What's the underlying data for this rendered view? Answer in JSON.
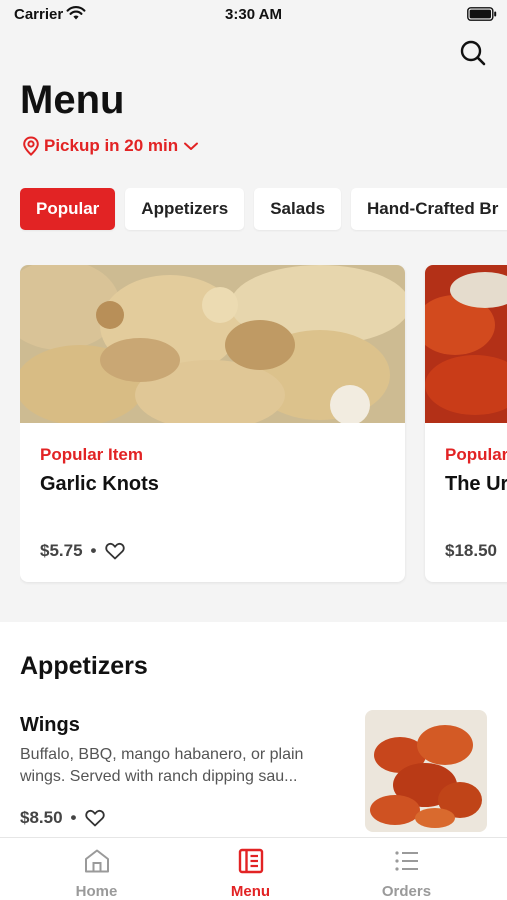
{
  "status_bar": {
    "carrier": "Carrier",
    "time": "3:30 AM"
  },
  "header": {
    "title": "Menu",
    "pickup_label": "Pickup in 20 min"
  },
  "categories": [
    {
      "label": "Popular",
      "active": true
    },
    {
      "label": "Appetizers",
      "active": false
    },
    {
      "label": "Salads",
      "active": false
    },
    {
      "label": "Hand-Crafted Br",
      "active": false
    }
  ],
  "popular_cards": [
    {
      "tag": "Popular Item",
      "name": "Garlic Knots",
      "price": "$5.75",
      "separator": "•"
    },
    {
      "tag": "Popular",
      "name": "The Ur",
      "price": "$18.50"
    }
  ],
  "appetizers": {
    "title": "Appetizers",
    "item": {
      "name": "Wings",
      "description": "Buffalo, BBQ, mango habanero, or plain wings. Served with ranch dipping sau...",
      "price": "$8.50",
      "separator": "•"
    }
  },
  "tabbar": [
    {
      "label": "Home",
      "icon": "home-icon",
      "active": false
    },
    {
      "label": "Menu",
      "icon": "menu-book-icon",
      "active": true
    },
    {
      "label": "Orders",
      "icon": "list-icon",
      "active": false
    }
  ],
  "colors": {
    "accent": "#e22324",
    "background": "#f4f4f4",
    "inactive": "#9a9a9a"
  }
}
